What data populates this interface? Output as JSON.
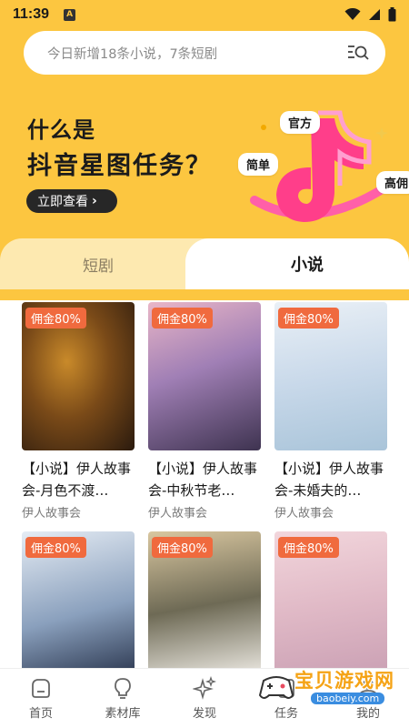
{
  "status_bar": {
    "time": "11:39",
    "notification_letter": "A"
  },
  "search": {
    "placeholder": "今日新增18条小说，7条短剧"
  },
  "banner": {
    "line1": "什么是",
    "line2": "抖音星图任务？",
    "button_label": "立即查看",
    "tags": [
      "官方",
      "简单",
      "高佣"
    ]
  },
  "tabs": [
    {
      "label": "短剧",
      "active": false
    },
    {
      "label": "小说",
      "active": true
    }
  ],
  "cards": [
    {
      "badge": "佣金80%",
      "title": "【小说】伊人故事会-月色不渡…",
      "author": "伊人故事会"
    },
    {
      "badge": "佣金80%",
      "title": "【小说】伊人故事会-中秋节老…",
      "author": "伊人故事会"
    },
    {
      "badge": "佣金80%",
      "title": "【小说】伊人故事会-未婚夫的…",
      "author": "伊人故事会"
    },
    {
      "badge": "佣金80%",
      "title": "",
      "author": ""
    },
    {
      "badge": "佣金80%",
      "title": "",
      "author": ""
    },
    {
      "badge": "佣金80%",
      "title": "",
      "author": ""
    }
  ],
  "bottom_nav": [
    {
      "label": "首页",
      "icon": "home-icon"
    },
    {
      "label": "素材库",
      "icon": "lightbulb-icon"
    },
    {
      "label": "发现",
      "icon": "sparkle-icon"
    },
    {
      "label": "任务",
      "icon": "task-icon"
    },
    {
      "label": "我的",
      "icon": "profile-icon"
    }
  ],
  "watermark": {
    "text": "宝贝游戏网",
    "sub": "baobeiy.com"
  },
  "colors": {
    "accent_yellow": "#fcc640",
    "badge_orange": "#f06a3e",
    "tab_inactive": "#fde9b0"
  }
}
